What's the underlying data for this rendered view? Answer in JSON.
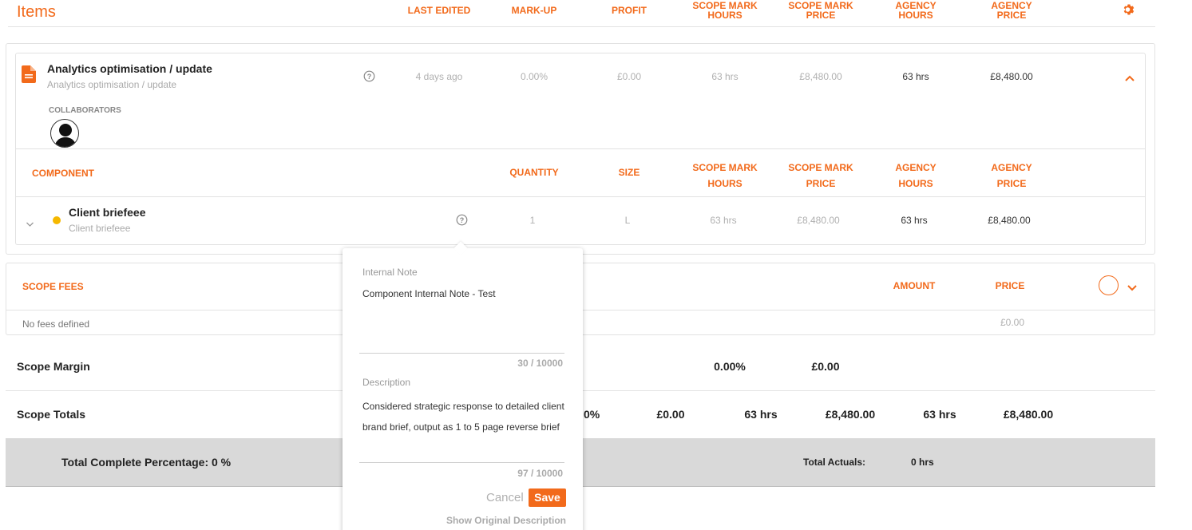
{
  "header": {
    "title": "Items",
    "columns": [
      "LAST EDITED",
      "MARK-UP",
      "PROFIT",
      "SCOPE MARK\nHOURS",
      "SCOPE MARK\nPRICE",
      "AGENCY\nHOURS",
      "AGENCY\nPRICE"
    ]
  },
  "item": {
    "name": "Analytics optimisation / update",
    "subtitle": "Analytics optimisation / update",
    "last_edited": "4 days ago",
    "markup": "0.00%",
    "profit": "£0.00",
    "scope_hours": "63 hrs",
    "scope_price": "£8,480.00",
    "agency_hours": "63 hrs",
    "agency_price": "£8,480.00",
    "collaborators_label": "COLLABORATORS"
  },
  "components": {
    "headers": {
      "component": "COMPONENT",
      "quantity": "QUANTITY",
      "size": "SIZE",
      "scope_hours": "SCOPE MARK\nHOURS",
      "scope_price": "SCOPE MARK\nPRICE",
      "agency_hours": "AGENCY\nHOURS",
      "agency_price": "AGENCY\nPRICE"
    },
    "rows": [
      {
        "name": "Client briefeee",
        "subtitle": "Client briefeee",
        "quantity": "1",
        "size": "L",
        "scope_hours": "63 hrs",
        "scope_price": "£8,480.00",
        "agency_hours": "63 hrs",
        "agency_price": "£8,480.00",
        "status_color": "#f5b800"
      }
    ]
  },
  "fees": {
    "label": "SCOPE FEES",
    "amount_label": "AMOUNT",
    "price_label": "PRICE",
    "empty_text": "No fees defined",
    "price_total": "£0.00"
  },
  "margin": {
    "label": "Scope Margin",
    "markup": "0.00%",
    "profit": "£0.00"
  },
  "totals": {
    "label": "Scope Totals",
    "markup_partial": "0%",
    "profit": "£0.00",
    "scope_hours": "63 hrs",
    "scope_price": "£8,480.00",
    "agency_hours": "63 hrs",
    "agency_price": "£8,480.00"
  },
  "footer": {
    "complete": "Total Complete Percentage: 0 %",
    "actuals_label": "Total Actuals:",
    "actuals_value": "0 hrs"
  },
  "popover": {
    "internal_note_label": "Internal Note",
    "internal_note_value": "Component Internal Note - Test",
    "internal_note_count": "30 / 10000",
    "description_label": "Description",
    "description_value": "Considered strategic response to detailed client brand brief, output as 1 to 5 page reverse brief",
    "description_count": "97 / 10000",
    "cancel": "Cancel",
    "save": "Save",
    "show_original": "Show Original Description"
  },
  "colors": {
    "accent": "#f26a1b",
    "status": "#f5b800",
    "footer_bg": "#d9d9d9"
  }
}
